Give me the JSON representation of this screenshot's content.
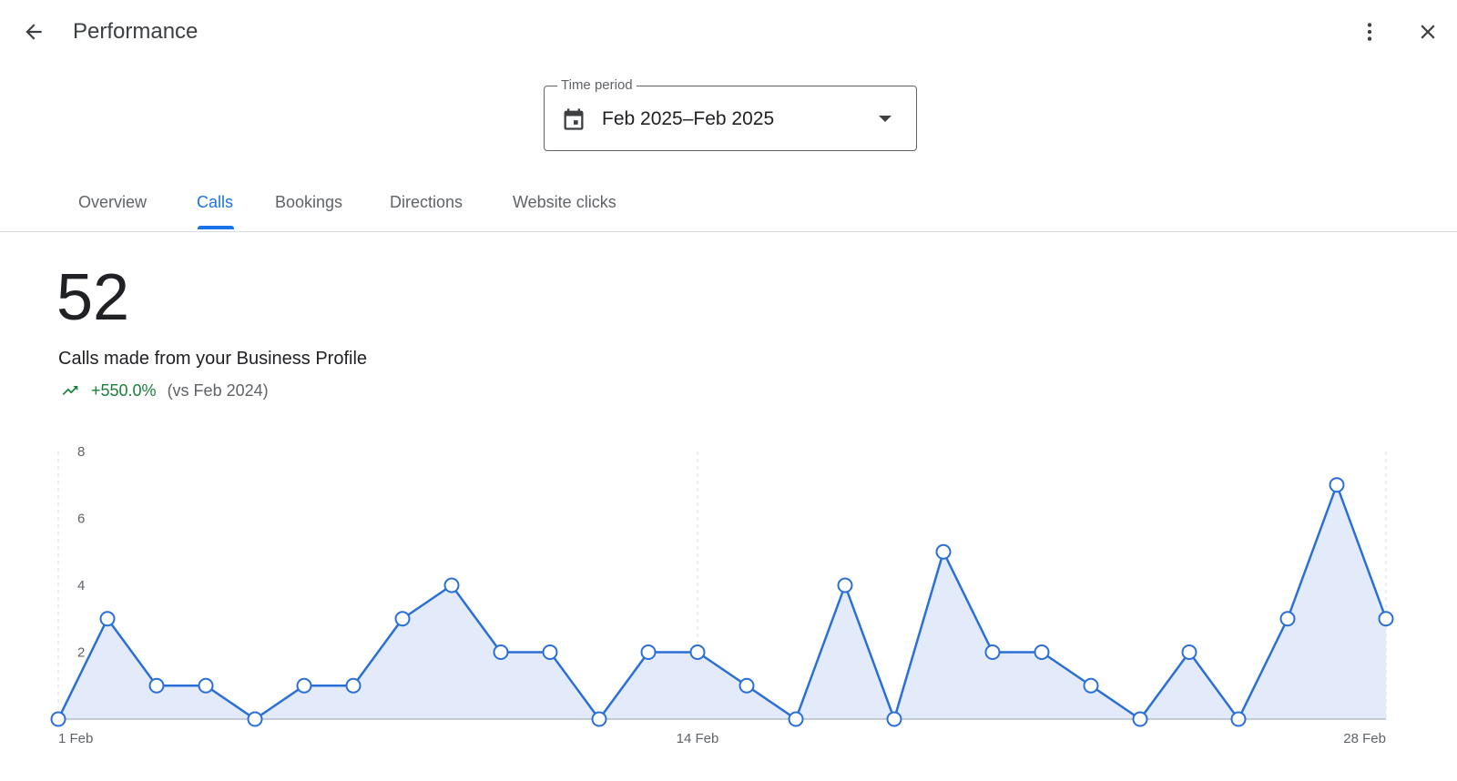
{
  "header": {
    "title": "Performance",
    "back_icon": "arrow-back-icon",
    "more_icon": "more-vert-icon",
    "close_icon": "close-icon"
  },
  "time_period": {
    "label": "Time period",
    "value": "Feb 2025–Feb 2025",
    "icon": "calendar-icon"
  },
  "tabs": [
    {
      "label": "Overview",
      "active": false
    },
    {
      "label": "Calls",
      "active": true
    },
    {
      "label": "Bookings",
      "active": false
    },
    {
      "label": "Directions",
      "active": false
    },
    {
      "label": "Website clicks",
      "active": false
    }
  ],
  "summary": {
    "total": "52",
    "description": "Calls made from your Business Profile",
    "change": "+550.0%",
    "comparison": "(vs Feb 2024)",
    "trend_icon": "trending-up-icon"
  },
  "colors": {
    "accent": "#1a73e8",
    "line": "#2a6fd6",
    "area": "#e3ebfa",
    "positive": "#188038"
  },
  "chart_data": {
    "type": "area",
    "x": [
      1,
      2,
      3,
      4,
      5,
      6,
      7,
      8,
      9,
      10,
      11,
      12,
      13,
      14,
      15,
      16,
      17,
      18,
      19,
      20,
      21,
      22,
      23,
      24,
      25,
      26,
      27,
      28
    ],
    "x_tick_labels": [
      "1 Feb",
      "14 Feb",
      "28 Feb"
    ],
    "x_tick_positions": [
      1,
      14,
      28
    ],
    "series": [
      {
        "values": [
          0,
          3,
          1,
          1,
          0,
          1,
          1,
          3,
          4,
          2,
          2,
          0,
          2,
          2,
          1,
          0,
          4,
          0,
          5,
          2,
          2,
          1,
          0,
          2,
          0,
          3,
          7,
          3
        ]
      }
    ],
    "y_ticks": [
      2,
      4,
      6,
      8
    ],
    "ylim": [
      0,
      8
    ],
    "grid": "vertical dashed at labeled dates",
    "legend": "none"
  }
}
